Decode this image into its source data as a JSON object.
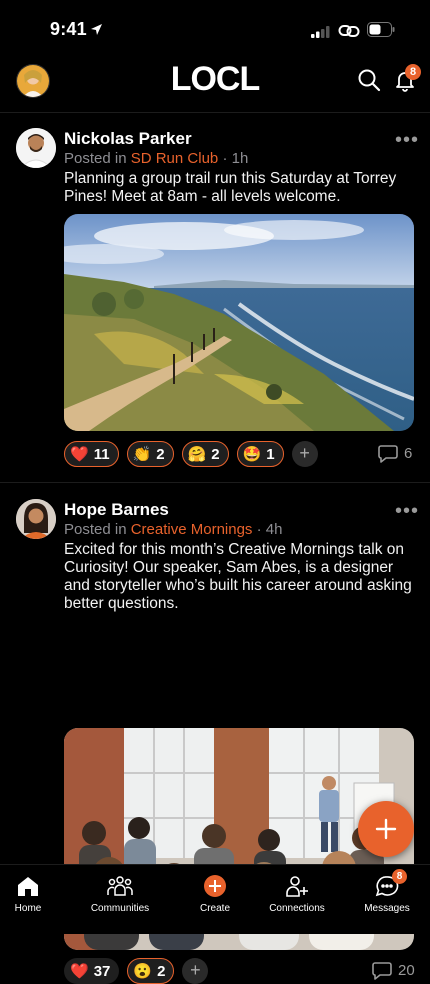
{
  "status": {
    "time": "9:41"
  },
  "header": {
    "logo": "LOCL",
    "notification_count": "8"
  },
  "posts": [
    {
      "author": "Nickolas Parker",
      "posted_in_prefix": "Posted in",
      "community": "SD Run Club",
      "time": "· 1h",
      "text": "Planning a group trail run this Saturday at Torrey Pines! Meet at 8am - all levels welcome.",
      "reactions": [
        {
          "emoji": "❤️",
          "count": "11"
        },
        {
          "emoji": "👏",
          "count": "2"
        },
        {
          "emoji": "🤗",
          "count": "2"
        },
        {
          "emoji": "🤩",
          "count": "1"
        }
      ],
      "comment_count": "6"
    },
    {
      "author": "Hope Barnes",
      "posted_in_prefix": "Posted in",
      "community": "Creative Mornings",
      "time": "· 4h",
      "text": "Excited for this month’s Creative Mornings talk on Curiosity! Our speaker, Sam Abes, is a designer and storyteller who’s built his career around asking better questions.",
      "reactions": [
        {
          "emoji": "❤️",
          "count": "37"
        },
        {
          "emoji": "😮",
          "count": "2"
        }
      ],
      "comment_count": "20"
    }
  ],
  "tabs": {
    "home": "Home",
    "communities": "Communities",
    "create": "Create",
    "connections": "Connections",
    "messages": "Messages",
    "messages_badge": "8"
  },
  "colors": {
    "accent": "#e8622c",
    "background": "#000000",
    "muted": "#8e8e93"
  }
}
